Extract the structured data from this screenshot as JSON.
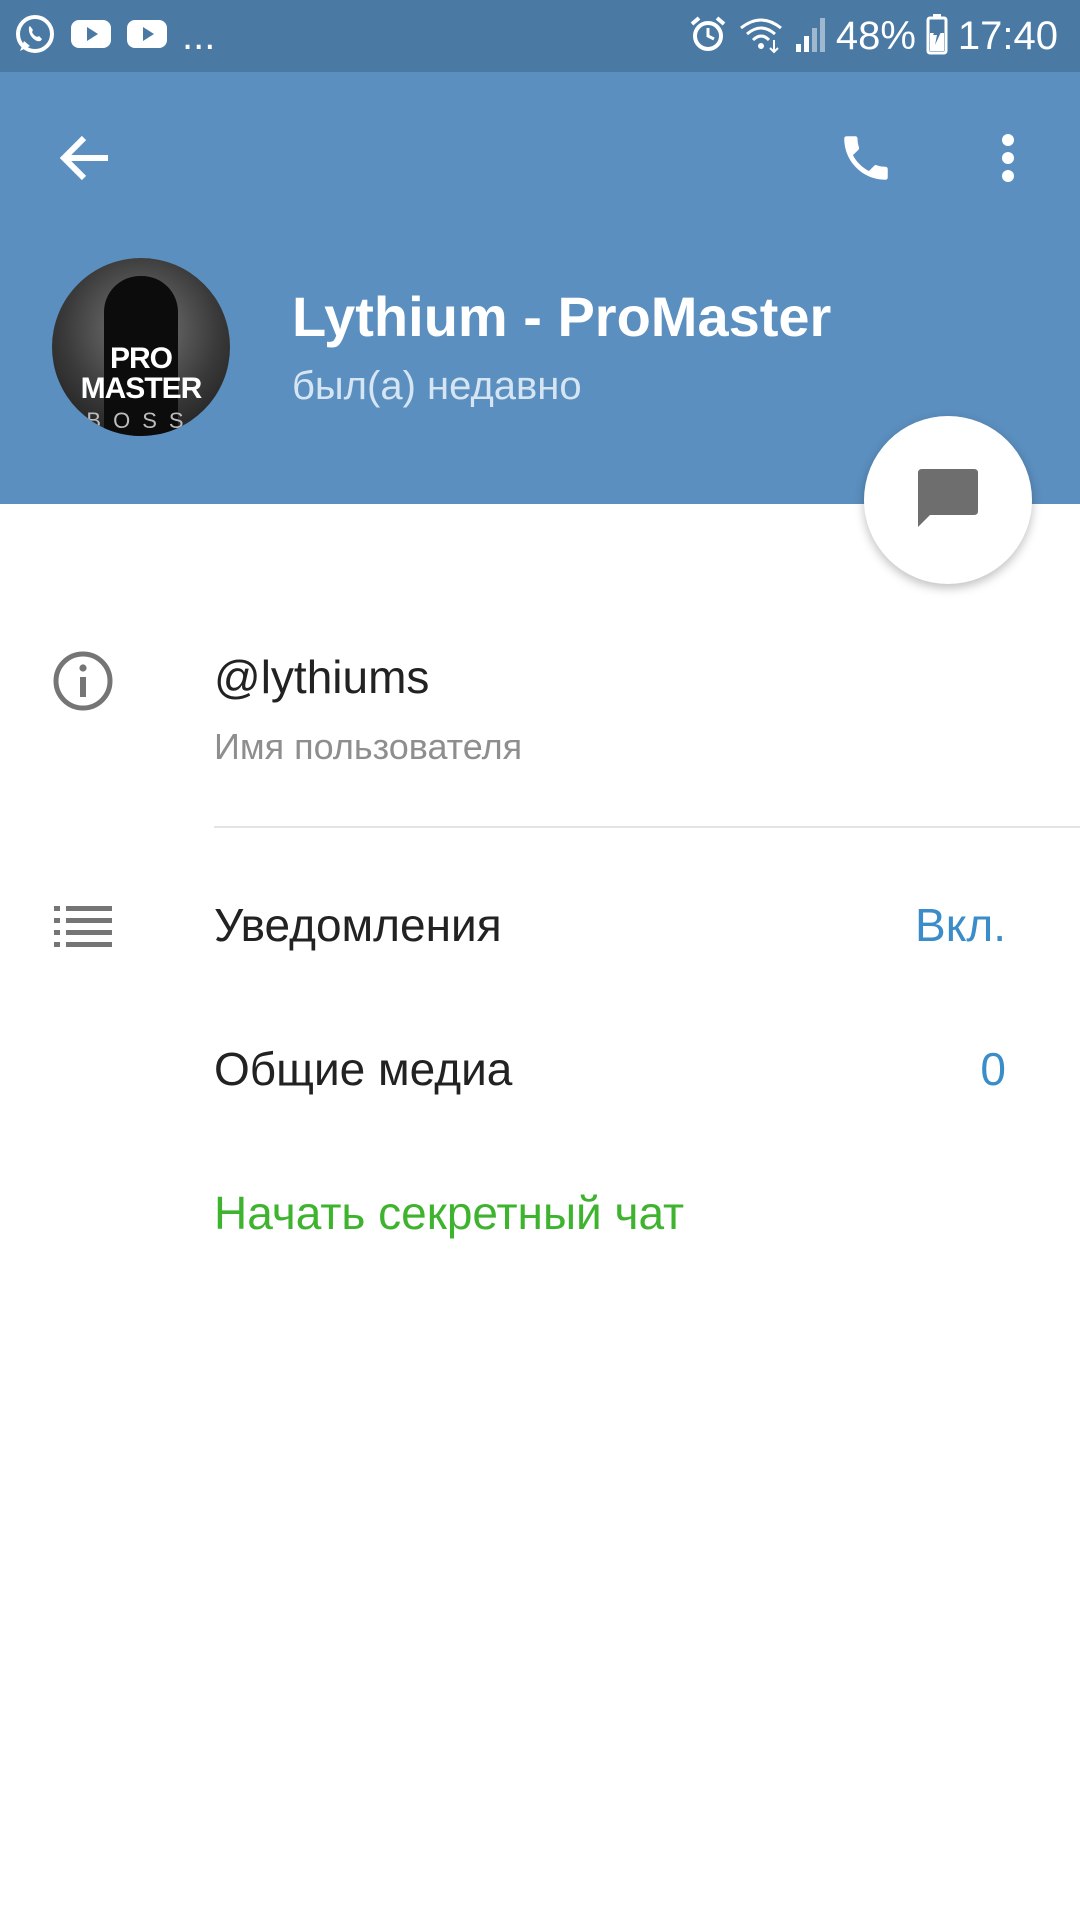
{
  "status_bar": {
    "left_icons": [
      "whatsapp-icon",
      "youtube-icon",
      "youtube-icon"
    ],
    "more_text": "...",
    "battery_percent": "48%",
    "time": "17:40",
    "right_icons": [
      "alarm-icon",
      "wifi-icon",
      "signal-icon",
      "battery-charging-icon"
    ]
  },
  "header": {
    "background_color": "#5b8fbf",
    "back_icon": "arrow-left-icon",
    "call_icon": "phone-icon",
    "menu_icon": "more-vertical-icon"
  },
  "profile": {
    "avatar_text_line1": "PRO",
    "avatar_text_line2": "MASTER",
    "avatar_text_line3": "BOSS",
    "name": "Lythium - ProMaster",
    "status": "был(а) недавно"
  },
  "fab": {
    "icon": "message-icon"
  },
  "info": {
    "icon": "info-icon",
    "username": "@lythiums",
    "username_caption": "Имя пользователя"
  },
  "settings": {
    "icon": "list-icon",
    "notifications_label": "Уведомления",
    "notifications_value": "Вкл.",
    "shared_media_label": "Общие медиа",
    "shared_media_value": "0",
    "secret_chat_label": "Начать секретный чат"
  },
  "colors": {
    "status_bar": "#4a7aa3",
    "accent_blue": "#3a8dc8",
    "secret_green": "#3db32e"
  }
}
